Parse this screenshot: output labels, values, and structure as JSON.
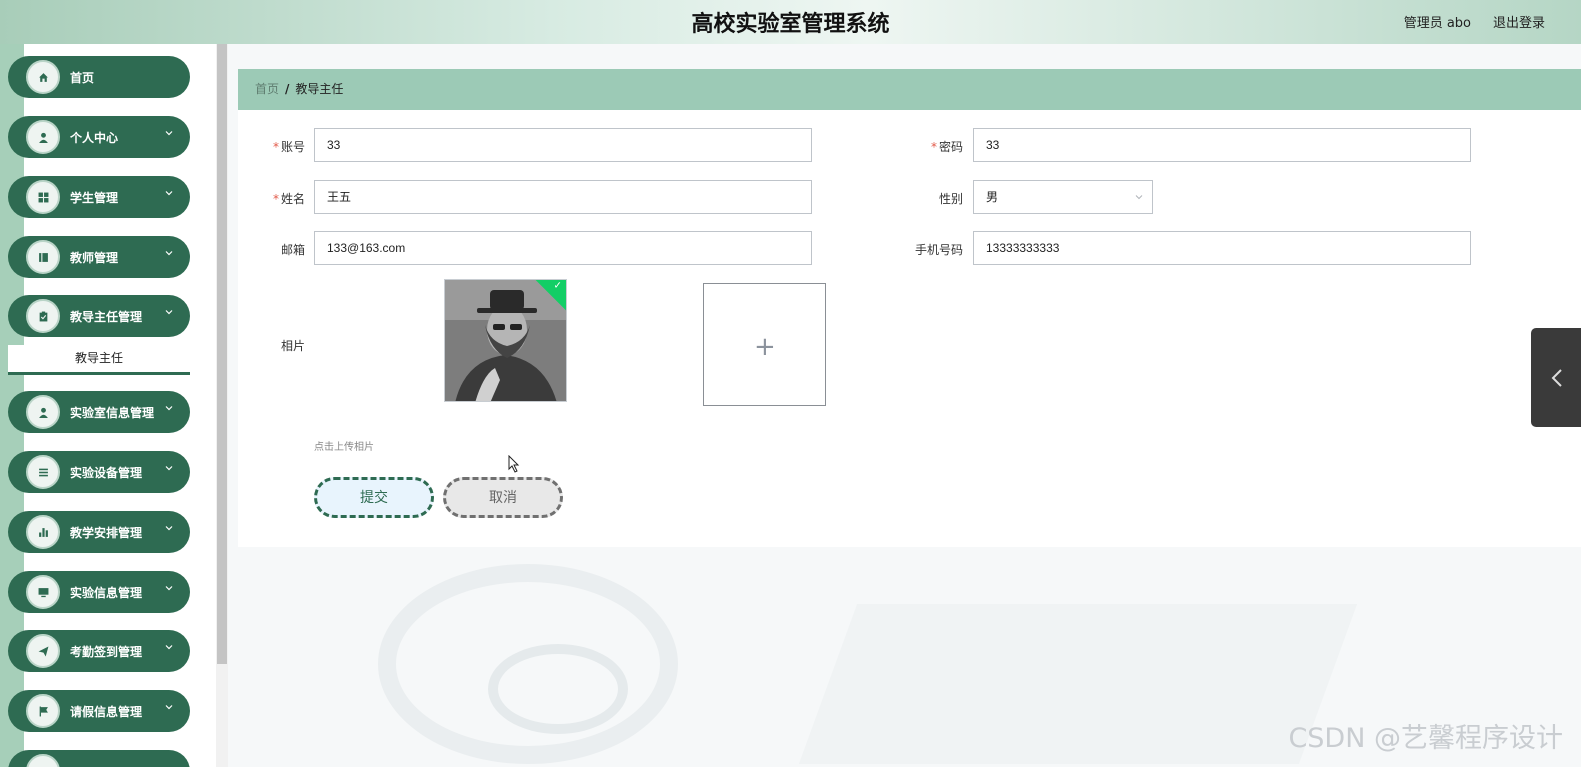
{
  "header": {
    "title": "高校实验室管理系统",
    "user": "管理员 abo",
    "logout": "退出登录"
  },
  "sidebar": {
    "items": [
      {
        "label": "首页",
        "icon": "home-icon"
      },
      {
        "label": "个人中心",
        "icon": "user-icon"
      },
      {
        "label": "学生管理",
        "icon": "grid-icon"
      },
      {
        "label": "教师管理",
        "icon": "book-icon"
      },
      {
        "label": "教导主任管理",
        "icon": "clipboard-icon"
      },
      {
        "label": "实验室信息管理",
        "icon": "user-icon"
      },
      {
        "label": "实验设备管理",
        "icon": "list-icon"
      },
      {
        "label": "教学安排管理",
        "icon": "bar-chart-icon"
      },
      {
        "label": "实验信息管理",
        "icon": "monitor-icon"
      },
      {
        "label": "考勤签到管理",
        "icon": "send-icon"
      },
      {
        "label": "请假信息管理",
        "icon": "flag-icon"
      }
    ],
    "active_sub": "教导主任"
  },
  "breadcrumb": {
    "home": "首页",
    "sep": "/",
    "current": "教导主任"
  },
  "form": {
    "account": {
      "label": "账号",
      "value": "33"
    },
    "password": {
      "label": "密码",
      "value": "33"
    },
    "name": {
      "label": "姓名",
      "value": "王五"
    },
    "gender": {
      "label": "性别",
      "value": "男"
    },
    "email": {
      "label": "邮箱",
      "value": "133@163.com"
    },
    "phone": {
      "label": "手机号码",
      "value": "13333333333"
    },
    "photo": {
      "label": "相片",
      "hint": "点击上传相片"
    },
    "submit": "提交",
    "cancel": "取消"
  },
  "watermark": "CSDN @艺馨程序设计",
  "colors": {
    "accent": "#2e6b52",
    "breadcrumb_bg": "#9ccab6",
    "required": "#e25a4a"
  }
}
